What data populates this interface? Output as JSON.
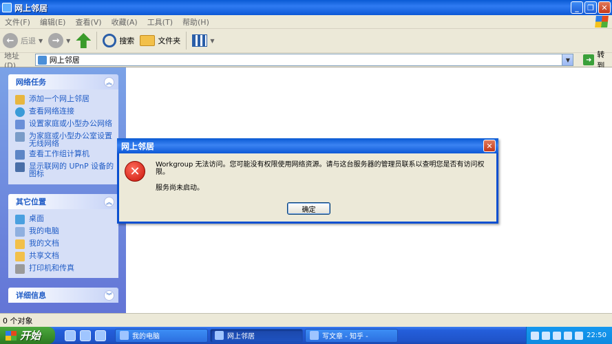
{
  "window": {
    "title": "网上邻居"
  },
  "menu": [
    "文件(F)",
    "编辑(E)",
    "查看(V)",
    "收藏(A)",
    "工具(T)",
    "帮助(H)"
  ],
  "toolbar": {
    "back": "后退",
    "search": "搜索",
    "folders": "文件夹"
  },
  "address": {
    "label": "地址(D)",
    "value": "网上邻居",
    "go": "转到"
  },
  "network_tasks": {
    "header": "网络任务",
    "items": [
      "添加一个网上邻居",
      "查看网络连接",
      "设置家庭或小型办公网络",
      "为家庭或小型办公室设置无线网络",
      "查看工作组计算机",
      "显示联网的 UPnP 设备的图标"
    ]
  },
  "other_places": {
    "header": "其它位置",
    "items": [
      "桌面",
      "我的电脑",
      "我的文档",
      "共享文档",
      "打印机和传真"
    ]
  },
  "details": {
    "header": "详细信息"
  },
  "status": {
    "text": "0 个对象"
  },
  "dialog": {
    "title": "网上邻居",
    "message": "Workgroup 无法访问。您可能没有权限使用网络资源。请与这台服务器的管理员联系以查明您是否有访问权限。",
    "message2": "服务尚未启动。",
    "ok": "确定"
  },
  "taskbar": {
    "start": "开始",
    "tasks": [
      "我的电脑",
      "网上邻居",
      "写文章 - 知乎 -"
    ],
    "clock": "22:50"
  },
  "colors": {
    "title_blue": "#0a5ad4",
    "link_blue": "#215dc6",
    "panel_bg": "#d6dff7",
    "start_green": "#3a8f2d"
  }
}
